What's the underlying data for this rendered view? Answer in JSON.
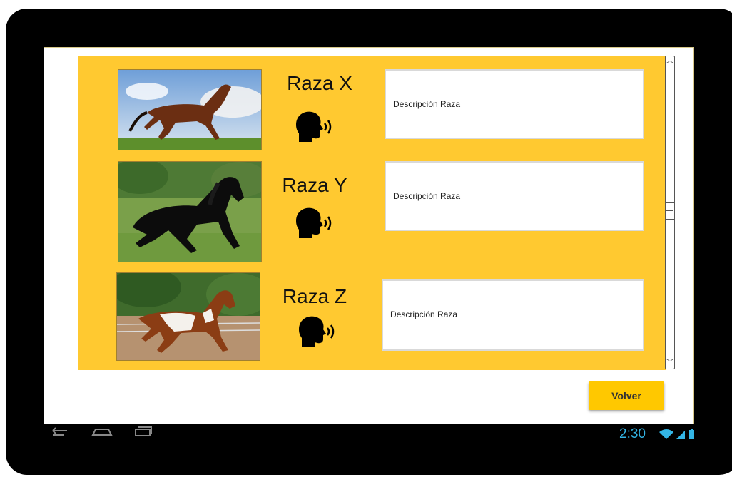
{
  "breeds": [
    {
      "name": "Raza X",
      "description": "Descripción Raza",
      "image_icon": "bay-horse-photo"
    },
    {
      "name": "Raza Y",
      "description": "Descripción Raza",
      "image_icon": "black-horse-photo"
    },
    {
      "name": "Raza Z",
      "description": "Descripción Raza",
      "image_icon": "pinto-horse-photo"
    }
  ],
  "actions": {
    "back_label": "Volver"
  },
  "status_bar": {
    "time": "2:30"
  },
  "colors": {
    "panel": "#ffc930",
    "button": "#ffc800",
    "status": "#33b5e5"
  }
}
